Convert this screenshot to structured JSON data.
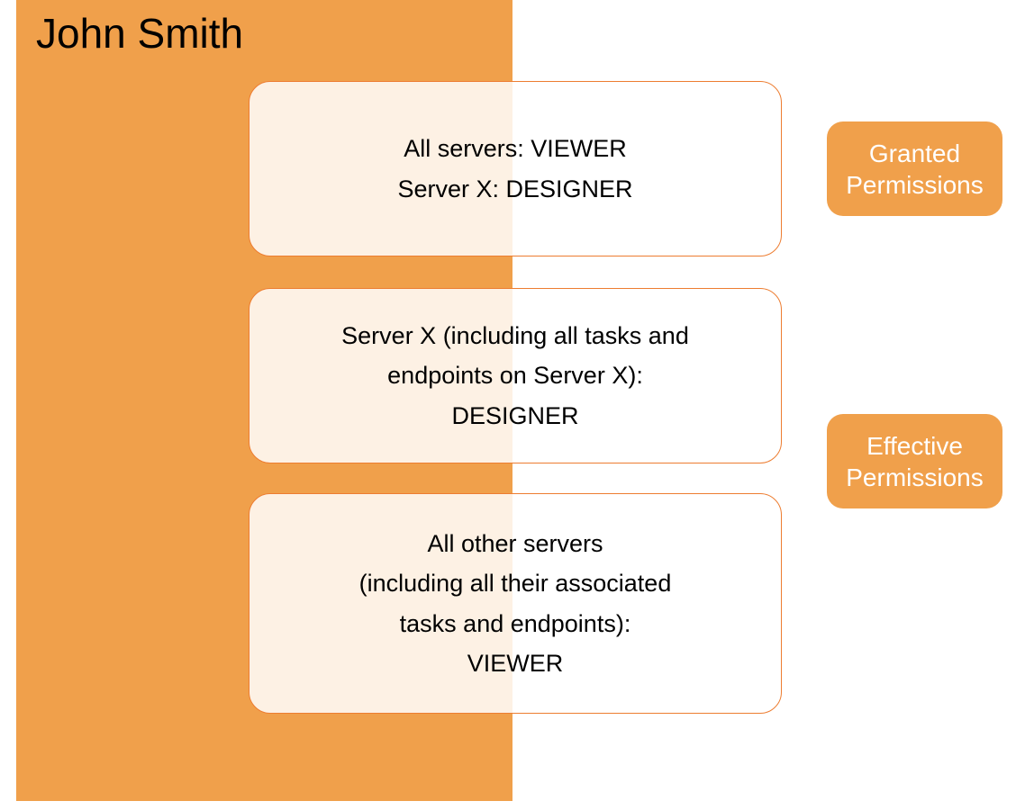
{
  "user_name": "John Smith",
  "granted_box": {
    "line1": "All servers: VIEWER",
    "line2": "Server X: DESIGNER"
  },
  "effective_box_1": {
    "line1": "Server X (including all tasks and",
    "line2": "endpoints on Server X):",
    "line3": "DESIGNER"
  },
  "effective_box_2": {
    "line1": "All other servers",
    "line2": "(including all their associated",
    "line3": "tasks and endpoints):",
    "line4": "VIEWER"
  },
  "labels": {
    "granted_line1": "Granted",
    "granted_line2": "Permissions",
    "effective_line1": "Effective",
    "effective_line2": "Permissions"
  }
}
